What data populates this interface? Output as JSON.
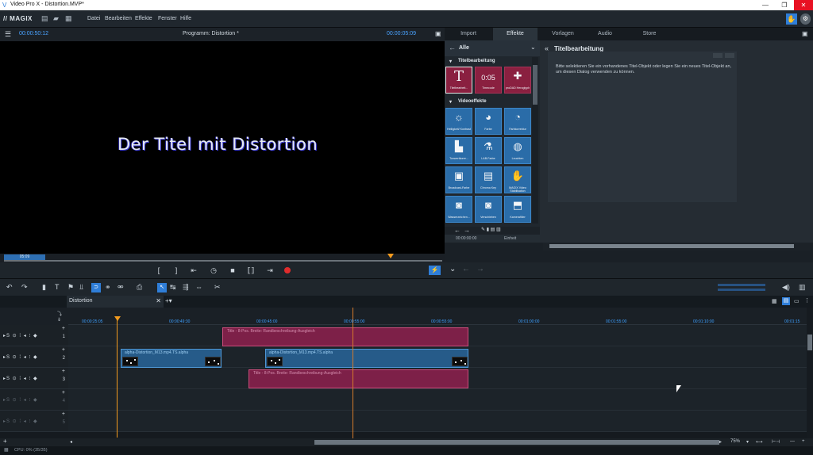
{
  "window": {
    "title": "Video Pro X - Distortion.MVP*"
  },
  "menu": {
    "logo": "// MAGIX",
    "items": [
      "Datei",
      "Bearbeiten",
      "Effekte",
      "Fenster",
      "Hilfe"
    ]
  },
  "preview": {
    "timecode_left": "00:00:50:12",
    "title": "Programm: Distortion *",
    "timecode_right": "00:00:05:09",
    "scene_text": "Der Titel mit Distortion",
    "scrub_label": "05:09"
  },
  "right_tabs": [
    "Import",
    "Effekte",
    "Vorlagen",
    "Audio",
    "Store"
  ],
  "media_pool": {
    "header": "Alle",
    "section_title": "Titelbearbeitung",
    "title_tiles": [
      {
        "label": "Titelbearbeit...",
        "glyph": "T"
      },
      {
        "label": "Timecode",
        "glyph": "0:05"
      },
      {
        "label": "proDAD Heroglyph",
        "glyph": "✚"
      }
    ],
    "section_video": "Videoeffekte",
    "video_tiles": [
      {
        "label": "Helligkeit/ Kontrast",
        "glyph": "☼"
      },
      {
        "label": "Farbe",
        "glyph": "◕"
      },
      {
        "label": "Farbkorrektur",
        "glyph": "◔"
      },
      {
        "label": "Tonwertkorre...",
        "glyph": "▙"
      },
      {
        "label": "LAB-Farbe",
        "glyph": "⚗"
      },
      {
        "label": "Leuchten",
        "glyph": "◍"
      },
      {
        "label": "Broadcast-Farbe",
        "glyph": "▣"
      },
      {
        "label": "Chroma Key",
        "glyph": "▤"
      },
      {
        "label": "MAGIX Video Stabilisation",
        "glyph": "✋"
      },
      {
        "label": "Wasserzeichen...",
        "glyph": "◙"
      },
      {
        "label": "Verschieben",
        "glyph": "◙"
      },
      {
        "label": "Kamerafilter",
        "glyph": "⬒"
      }
    ],
    "footer_time": "00:00:00:00",
    "footer_unit": "Einheit"
  },
  "title_editor": {
    "header": "Titelbearbeitung",
    "message": "Bitte selektieren Sie ein vorhandenes Titel-Objekt oder legen Sie ein neues Titel-Objekt an, um diesen Dialog verwenden zu können."
  },
  "timeline": {
    "sequence_tab": "Distortion",
    "ruler_labels": [
      "00:00:25:05",
      "00:00:49:30",
      "00:00:45:00",
      "00:00:55:00",
      "00:00:55:00",
      "00:01:00:00",
      "00:01:55:00",
      "00:01:10:00",
      "00:01:15"
    ],
    "tracks": [
      {
        "num": "1",
        "icons": "▸S ⊙ ⁞ ◂ ⁝ ◆"
      },
      {
        "num": "2",
        "icons": "▸S ⊙ ⁞ ◂ ⁝ ◆"
      },
      {
        "num": "3",
        "icons": "▸S ⊙ ⁞ ◂ ⁝ ◆"
      },
      {
        "num": "4",
        "icons": "▸S ⊙ ⁞ ◂ ⁝ ◆"
      },
      {
        "num": "5",
        "icons": "▸S ⊙ ⁞ ◂ ⁝ ◆"
      }
    ],
    "clips": {
      "title_top": "Title - 8-Pos. Breite: Randbeschreibung-Ausgleich",
      "video_a": "alpha-Distortion_M13.mp4.TS.alpha",
      "video_b": "alpha-Distortion_M13.mp4.TS.alpha",
      "title_bottom": "Title - 8-Pos. Breite: Randbeschreibung-Ausgleich"
    },
    "zoom": "75%"
  },
  "status": {
    "cpu": "CPU: 0% (35/35)"
  },
  "colors": {
    "accent": "#2f7ed8",
    "playhead": "#f29a1e",
    "title_clip": "#7d2048",
    "video_clip": "#265b89"
  }
}
